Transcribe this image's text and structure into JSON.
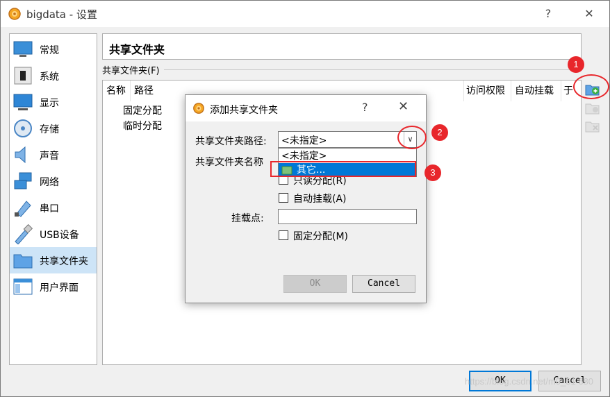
{
  "window": {
    "title": "bigdata - 设置",
    "help_glyph": "?",
    "close_glyph": "✕"
  },
  "sidebar": {
    "items": [
      {
        "label": "常规",
        "icon": "general-icon"
      },
      {
        "label": "系统",
        "icon": "system-icon"
      },
      {
        "label": "显示",
        "icon": "display-icon"
      },
      {
        "label": "存储",
        "icon": "storage-icon"
      },
      {
        "label": "声音",
        "icon": "audio-icon"
      },
      {
        "label": "网络",
        "icon": "network-icon"
      },
      {
        "label": "串口",
        "icon": "serial-port-icon"
      },
      {
        "label": "USB设备",
        "icon": "usb-icon"
      },
      {
        "label": "共享文件夹",
        "icon": "shared-folder-icon"
      },
      {
        "label": "用户界面",
        "icon": "user-interface-icon"
      }
    ],
    "selected": "共享文件夹"
  },
  "main": {
    "section_title": "共享文件夹",
    "group_label": "共享文件夹(F)",
    "columns": [
      "名称",
      "路径",
      "访问权限",
      "自动挂载",
      "于"
    ],
    "rows": [
      "固定分配",
      "临时分配"
    ]
  },
  "footer": {
    "ok_label": "OK",
    "cancel_label": "Cancel",
    "watermark": "https://blog.csdn.net/m0_51 680"
  },
  "dialog": {
    "title": "添加共享文件夹",
    "help_glyph": "?",
    "close_glyph": "✕",
    "path_label": "共享文件夹路径:",
    "path_value": "<未指定>",
    "name_label": "共享文件夹名称",
    "dropdown_options": [
      "<未指定>",
      "其它..."
    ],
    "readonly_label": "只读分配(R)",
    "automount_label": "自动挂载(A)",
    "mountpoint_label": "挂载点:",
    "permanent_label": "固定分配(M)",
    "ok_label": "OK",
    "cancel_label": "Cancel"
  },
  "annotations": [
    "1",
    "2",
    "3"
  ],
  "colors": {
    "accent": "#0078d7",
    "selection": "#cde4f7",
    "annotation": "#e8262b"
  }
}
